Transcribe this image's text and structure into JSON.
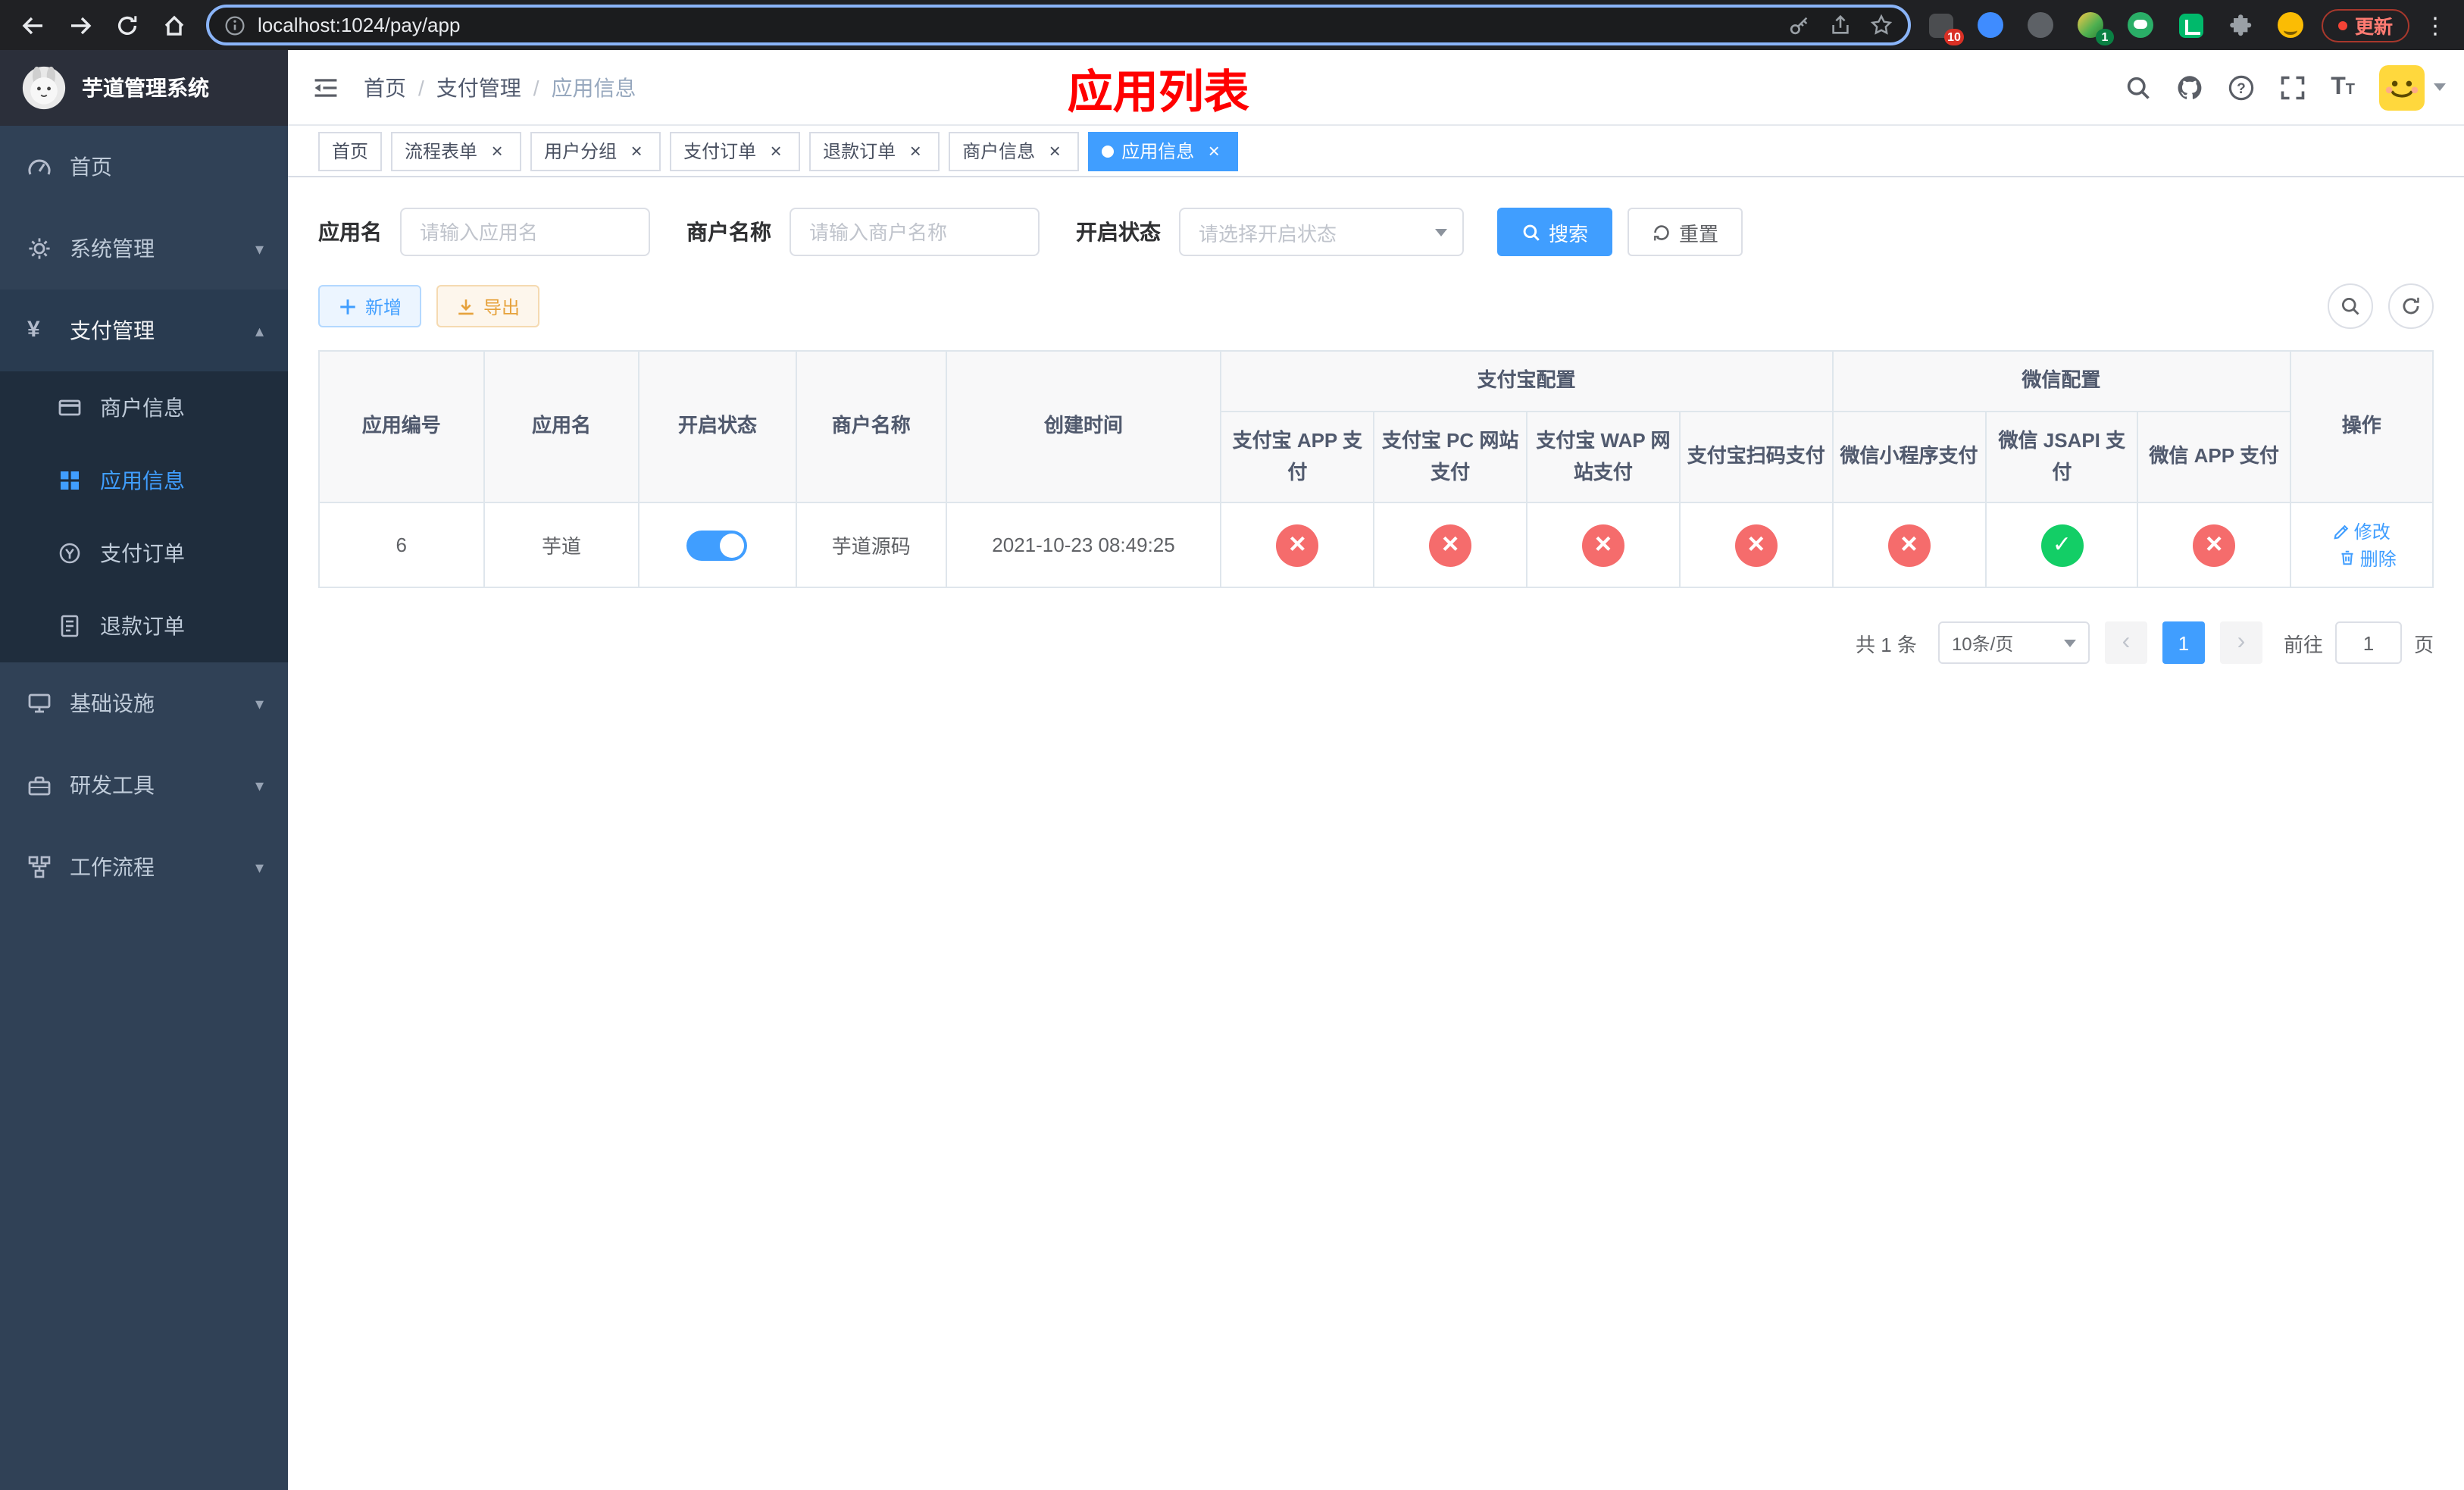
{
  "browser": {
    "url": "localhost:1024/pay/app",
    "update_label": "更新",
    "extensions": {
      "badge_1": "10",
      "badge_4": "1"
    }
  },
  "icons": {
    "close": "×",
    "chevron_down": "▾",
    "chevron_up": "▴",
    "dots_vertical": "⋮",
    "yen": "¥",
    "breadcrumb_separator": "/",
    "page_prev": "‹",
    "page_next": "›",
    "font_size_large": "T",
    "font_size_small": "T"
  },
  "sidebar": {
    "logo_title": "芋道管理系统",
    "items": {
      "home": "首页",
      "system": "系统管理",
      "payment": "支付管理",
      "infra": "基础设施",
      "devtools": "研发工具",
      "workflow": "工作流程"
    },
    "payment_children": {
      "merchant": "商户信息",
      "app": "应用信息",
      "pay_order": "支付订单",
      "refund_order": "退款订单"
    }
  },
  "header": {
    "breadcrumb": [
      "首页",
      "支付管理",
      "应用信息"
    ],
    "page_title": "应用列表"
  },
  "tabs": [
    {
      "label": "首页",
      "closable": false,
      "active": false
    },
    {
      "label": "流程表单",
      "closable": true,
      "active": false
    },
    {
      "label": "用户分组",
      "closable": true,
      "active": false
    },
    {
      "label": "支付订单",
      "closable": true,
      "active": false
    },
    {
      "label": "退款订单",
      "closable": true,
      "active": false
    },
    {
      "label": "商户信息",
      "closable": true,
      "active": false
    },
    {
      "label": "应用信息",
      "closable": true,
      "active": true
    }
  ],
  "filters": {
    "app_name_label": "应用名",
    "app_name_placeholder": "请输入应用名",
    "merchant_label": "商户名称",
    "merchant_placeholder": "请输入商户名称",
    "status_label": "开启状态",
    "status_placeholder": "请选择开启状态",
    "search_label": "搜索",
    "reset_label": "重置"
  },
  "toolbar": {
    "add_label": "新增",
    "export_label": "导出"
  },
  "table": {
    "columns": {
      "app_id": "应用编号",
      "app_name": "应用名",
      "status": "开启状态",
      "merchant_name": "商户名称",
      "create_time": "创建时间",
      "actions": "操作",
      "alipay_group": "支付宝配置",
      "wechat_group": "微信配置",
      "alipay_app": "支付宝 APP 支付",
      "alipay_pc": "支付宝 PC 网站支付",
      "alipay_wap": "支付宝 WAP 网站支付",
      "alipay_qr": "支付宝扫码支付",
      "wechat_mini": "微信小程序支付",
      "wechat_jsapi": "微信 JSAPI 支付",
      "wechat_app": "微信 APP 支付"
    },
    "rows": [
      {
        "app_id": "6",
        "app_name": "芋道",
        "enabled": true,
        "merchant_name": "芋道源码",
        "create_time": "2021-10-23 08:49:25",
        "alipay_app": false,
        "alipay_pc": false,
        "alipay_wap": false,
        "alipay_qr": false,
        "wechat_mini": false,
        "wechat_jsapi": true,
        "wechat_app": false,
        "edit_label": "修改",
        "delete_label": "删除"
      }
    ]
  },
  "pagination": {
    "total_text": "共 1 条",
    "page_size_text": "10条/页",
    "current_page": "1",
    "goto_label": "前往",
    "goto_value": "1",
    "goto_suffix": "页"
  },
  "colors": {
    "accent_blue": "#409eff",
    "success_green": "#13ce66",
    "danger_red": "#f56c6c",
    "warning_orange": "#e6a23c",
    "title_red": "#ff0000",
    "sidebar_bg": "#304156",
    "submenu_bg": "#1f2d3d",
    "chrome_bg": "#202124"
  }
}
